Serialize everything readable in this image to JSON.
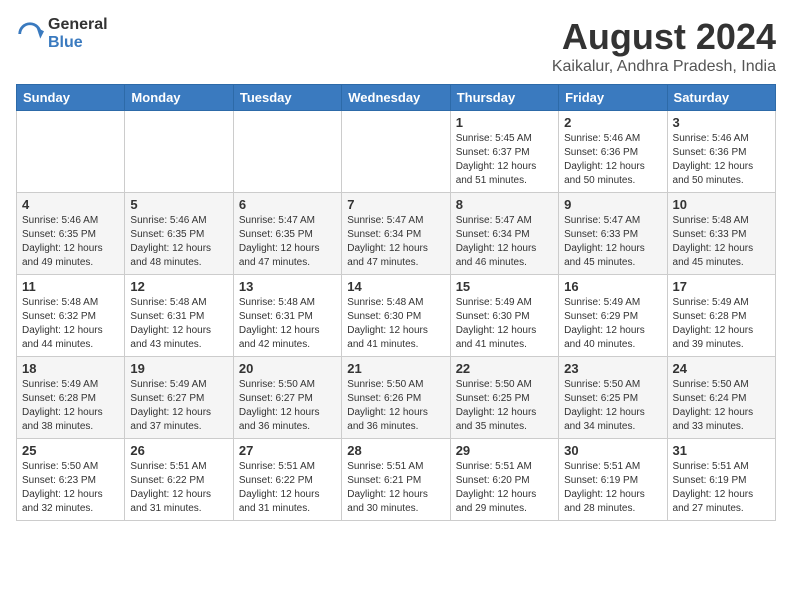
{
  "logo": {
    "general": "General",
    "blue": "Blue"
  },
  "header": {
    "month": "August 2024",
    "location": "Kaikalur, Andhra Pradesh, India"
  },
  "weekdays": [
    "Sunday",
    "Monday",
    "Tuesday",
    "Wednesday",
    "Thursday",
    "Friday",
    "Saturday"
  ],
  "weeks": [
    [
      {
        "day": "",
        "info": ""
      },
      {
        "day": "",
        "info": ""
      },
      {
        "day": "",
        "info": ""
      },
      {
        "day": "",
        "info": ""
      },
      {
        "day": "1",
        "info": "Sunrise: 5:45 AM\nSunset: 6:37 PM\nDaylight: 12 hours\nand 51 minutes."
      },
      {
        "day": "2",
        "info": "Sunrise: 5:46 AM\nSunset: 6:36 PM\nDaylight: 12 hours\nand 50 minutes."
      },
      {
        "day": "3",
        "info": "Sunrise: 5:46 AM\nSunset: 6:36 PM\nDaylight: 12 hours\nand 50 minutes."
      }
    ],
    [
      {
        "day": "4",
        "info": "Sunrise: 5:46 AM\nSunset: 6:35 PM\nDaylight: 12 hours\nand 49 minutes."
      },
      {
        "day": "5",
        "info": "Sunrise: 5:46 AM\nSunset: 6:35 PM\nDaylight: 12 hours\nand 48 minutes."
      },
      {
        "day": "6",
        "info": "Sunrise: 5:47 AM\nSunset: 6:35 PM\nDaylight: 12 hours\nand 47 minutes."
      },
      {
        "day": "7",
        "info": "Sunrise: 5:47 AM\nSunset: 6:34 PM\nDaylight: 12 hours\nand 47 minutes."
      },
      {
        "day": "8",
        "info": "Sunrise: 5:47 AM\nSunset: 6:34 PM\nDaylight: 12 hours\nand 46 minutes."
      },
      {
        "day": "9",
        "info": "Sunrise: 5:47 AM\nSunset: 6:33 PM\nDaylight: 12 hours\nand 45 minutes."
      },
      {
        "day": "10",
        "info": "Sunrise: 5:48 AM\nSunset: 6:33 PM\nDaylight: 12 hours\nand 45 minutes."
      }
    ],
    [
      {
        "day": "11",
        "info": "Sunrise: 5:48 AM\nSunset: 6:32 PM\nDaylight: 12 hours\nand 44 minutes."
      },
      {
        "day": "12",
        "info": "Sunrise: 5:48 AM\nSunset: 6:31 PM\nDaylight: 12 hours\nand 43 minutes."
      },
      {
        "day": "13",
        "info": "Sunrise: 5:48 AM\nSunset: 6:31 PM\nDaylight: 12 hours\nand 42 minutes."
      },
      {
        "day": "14",
        "info": "Sunrise: 5:48 AM\nSunset: 6:30 PM\nDaylight: 12 hours\nand 41 minutes."
      },
      {
        "day": "15",
        "info": "Sunrise: 5:49 AM\nSunset: 6:30 PM\nDaylight: 12 hours\nand 41 minutes."
      },
      {
        "day": "16",
        "info": "Sunrise: 5:49 AM\nSunset: 6:29 PM\nDaylight: 12 hours\nand 40 minutes."
      },
      {
        "day": "17",
        "info": "Sunrise: 5:49 AM\nSunset: 6:28 PM\nDaylight: 12 hours\nand 39 minutes."
      }
    ],
    [
      {
        "day": "18",
        "info": "Sunrise: 5:49 AM\nSunset: 6:28 PM\nDaylight: 12 hours\nand 38 minutes."
      },
      {
        "day": "19",
        "info": "Sunrise: 5:49 AM\nSunset: 6:27 PM\nDaylight: 12 hours\nand 37 minutes."
      },
      {
        "day": "20",
        "info": "Sunrise: 5:50 AM\nSunset: 6:27 PM\nDaylight: 12 hours\nand 36 minutes."
      },
      {
        "day": "21",
        "info": "Sunrise: 5:50 AM\nSunset: 6:26 PM\nDaylight: 12 hours\nand 36 minutes."
      },
      {
        "day": "22",
        "info": "Sunrise: 5:50 AM\nSunset: 6:25 PM\nDaylight: 12 hours\nand 35 minutes."
      },
      {
        "day": "23",
        "info": "Sunrise: 5:50 AM\nSunset: 6:25 PM\nDaylight: 12 hours\nand 34 minutes."
      },
      {
        "day": "24",
        "info": "Sunrise: 5:50 AM\nSunset: 6:24 PM\nDaylight: 12 hours\nand 33 minutes."
      }
    ],
    [
      {
        "day": "25",
        "info": "Sunrise: 5:50 AM\nSunset: 6:23 PM\nDaylight: 12 hours\nand 32 minutes."
      },
      {
        "day": "26",
        "info": "Sunrise: 5:51 AM\nSunset: 6:22 PM\nDaylight: 12 hours\nand 31 minutes."
      },
      {
        "day": "27",
        "info": "Sunrise: 5:51 AM\nSunset: 6:22 PM\nDaylight: 12 hours\nand 31 minutes."
      },
      {
        "day": "28",
        "info": "Sunrise: 5:51 AM\nSunset: 6:21 PM\nDaylight: 12 hours\nand 30 minutes."
      },
      {
        "day": "29",
        "info": "Sunrise: 5:51 AM\nSunset: 6:20 PM\nDaylight: 12 hours\nand 29 minutes."
      },
      {
        "day": "30",
        "info": "Sunrise: 5:51 AM\nSunset: 6:19 PM\nDaylight: 12 hours\nand 28 minutes."
      },
      {
        "day": "31",
        "info": "Sunrise: 5:51 AM\nSunset: 6:19 PM\nDaylight: 12 hours\nand 27 minutes."
      }
    ]
  ]
}
